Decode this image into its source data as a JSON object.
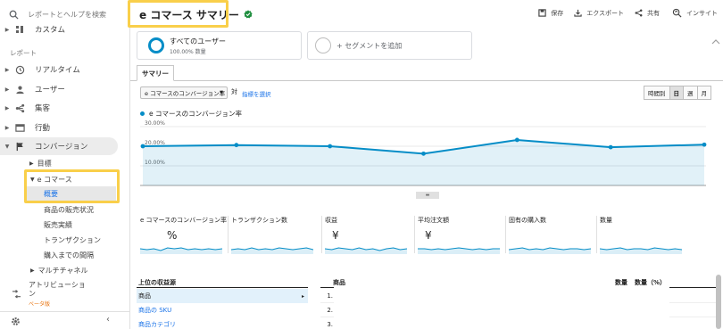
{
  "sidebar": {
    "search_placeholder": "レポートとヘルプを検索",
    "custom_label": "カスタム",
    "section_report": "レポート",
    "items": [
      {
        "label": "リアルタイム"
      },
      {
        "label": "ユーザー"
      },
      {
        "label": "集客"
      },
      {
        "label": "行動"
      },
      {
        "label": "コンバージョン"
      }
    ],
    "goals_label": "目標",
    "ecommerce_label": "e コマース",
    "sub_items": [
      "概要",
      "商品の販売状況",
      "販売実績",
      "トランザクション",
      "購入までの間隔"
    ],
    "multichannel_label": "マルチチャネル",
    "attribution_label": "アトリビューション",
    "beta_label": "ベータ版"
  },
  "header": {
    "title": "e コマース サマリー",
    "save_label": "保存",
    "export_label": "エクスポート",
    "share_label": "共有",
    "insights_label": "インサイト"
  },
  "segments": {
    "all_users_label": "すべてのユーザー",
    "all_users_sub": "100.00% 数量",
    "add_segment_label": "+ セグメントを追加"
  },
  "tabs": {
    "summary_label": "サマリー"
  },
  "controls": {
    "metric_select": "e コマースのコンバージョン率",
    "vs_label": "対",
    "select_metric_link": "指標を選択",
    "time_buttons": [
      "時間別",
      "日",
      "週",
      "月"
    ],
    "selected_time": "日"
  },
  "chart_data": {
    "type": "line",
    "series": [
      {
        "name": "e コマースのコンバージョン率",
        "values": [
          20.0,
          20.6,
          20.0,
          16.2,
          23.2,
          19.5,
          20.8
        ]
      }
    ],
    "y_ticks": [
      "30.00%",
      "20.00%",
      "10.00%"
    ],
    "ylim": [
      0,
      30
    ],
    "grid": true,
    "area_fill": true,
    "series_color": "#058dc7"
  },
  "scorecards": [
    {
      "label": "e コマースのコンバージョン率",
      "value": "%"
    },
    {
      "label": "トランザクション数",
      "value": ""
    },
    {
      "label": "収益",
      "value": "¥"
    },
    {
      "label": "平均注文額",
      "value": "¥"
    },
    {
      "label": "固有の購入数",
      "value": ""
    },
    {
      "label": "数量",
      "value": ""
    }
  ],
  "table": {
    "source_header": "上位の収益源",
    "product_header": "商品",
    "qty_header": "数量",
    "qty_pct_header": "数量（%）",
    "sources": [
      "商品",
      "商品の SKU",
      "商品カテゴリ"
    ],
    "rows": [
      "1.",
      "2.",
      "3."
    ]
  },
  "colors": {
    "accent": "#058dc7",
    "highlight": "#f9cf4a",
    "link": "#1a73e8",
    "verified": "#1e8e3e"
  }
}
